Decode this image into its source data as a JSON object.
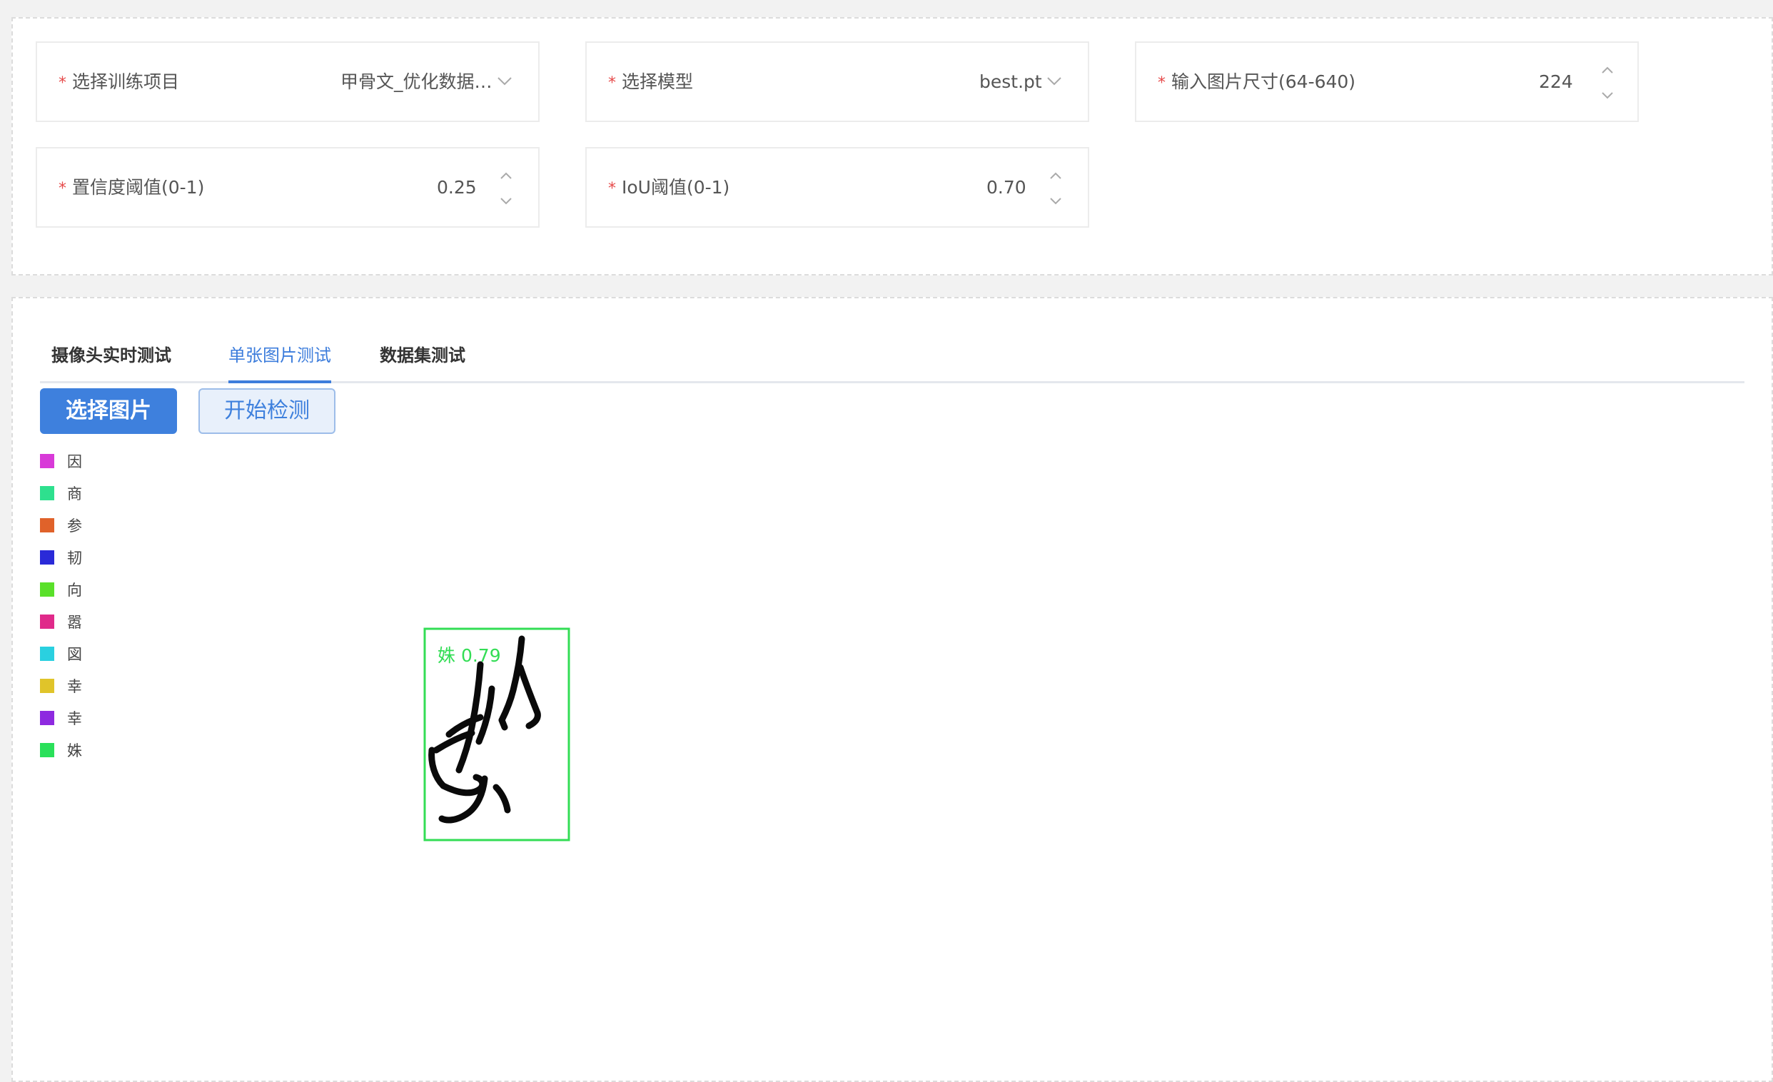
{
  "settings": {
    "project": {
      "label": "选择训练项目",
      "value": "甲骨文_优化数据…"
    },
    "model": {
      "label": "选择模型",
      "value": "best.pt"
    },
    "imgsize": {
      "label": "输入图片尺寸(64-640)",
      "value": "224"
    },
    "conf": {
      "label": "置信度阈值(0-1)",
      "value": "0.25"
    },
    "iou": {
      "label": "IoU阈值(0-1)",
      "value": "0.70"
    }
  },
  "tabs": [
    {
      "label": "摄像头实时测试",
      "active": false
    },
    {
      "label": "单张图片测试",
      "active": true
    },
    {
      "label": "数据集测试",
      "active": false
    }
  ],
  "buttons": {
    "select": "选择图片",
    "start": "开始检测"
  },
  "legend": [
    {
      "label": "因",
      "color": "#d83ad8"
    },
    {
      "label": "商",
      "color": "#2ee08e"
    },
    {
      "label": "参",
      "color": "#e0622a"
    },
    {
      "label": "韧",
      "color": "#2a2ad8"
    },
    {
      "label": "向",
      "color": "#5ae02a"
    },
    {
      "label": "嚣",
      "color": "#e02a8a"
    },
    {
      "label": "図",
      "color": "#2ad0e0"
    },
    {
      "label": "幸",
      "color": "#e0c42a"
    },
    {
      "label": "幸",
      "color": "#8e2ae0"
    },
    {
      "label": "姝",
      "color": "#2ae05a"
    }
  ],
  "detection": {
    "label": "姝 0.79",
    "color": "#33dd55"
  },
  "colors": {
    "accent": "#3d7ddc",
    "required": "#e64a4a"
  }
}
